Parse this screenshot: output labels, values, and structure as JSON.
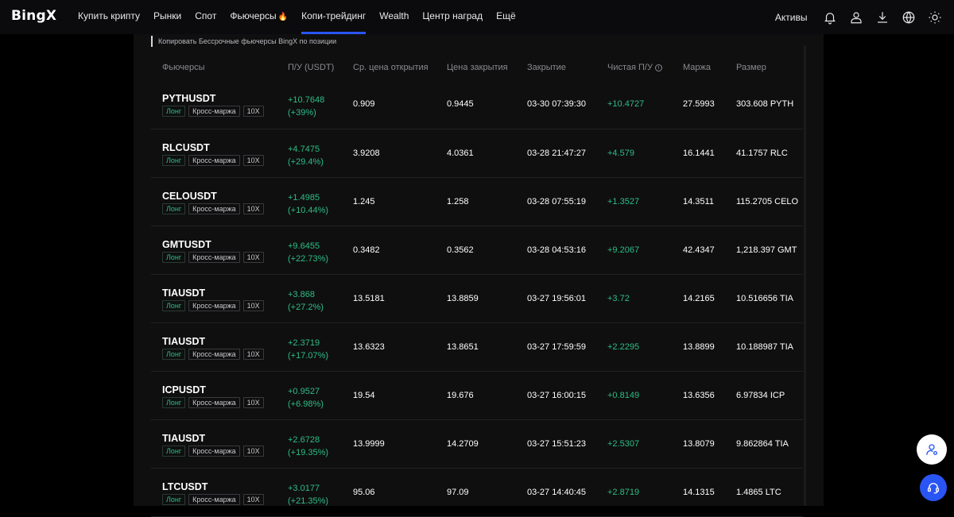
{
  "brand": {
    "logo": "BingX",
    "accent": "#2a55f5",
    "positive": "#2ebd85"
  },
  "nav": {
    "links": [
      {
        "label": "Купить крипту"
      },
      {
        "label": "Рынки"
      },
      {
        "label": "Спот"
      },
      {
        "label": "Фьючерсы"
      },
      {
        "label": "Копи-трейдинг",
        "active": true
      },
      {
        "label": "Wealth"
      },
      {
        "label": "Центр наград"
      },
      {
        "label": "Ещё"
      }
    ],
    "assets_label": "Активы",
    "icons": [
      "bell-icon",
      "user-icon",
      "download-icon",
      "globe-icon",
      "sun-icon"
    ]
  },
  "section_title": "Копировать Бессрочные фьючерсы BingX по позиции",
  "table": {
    "headers": {
      "futures": "Фьючерсы",
      "pnl": "П/У (USDT)",
      "open_price": "Ср. цена открытия",
      "close_price": "Цена закрытия",
      "close_time": "Закрытие",
      "net_pnl": "Чистая П/У",
      "margin": "Маржа",
      "size": "Размер"
    },
    "tags": {
      "side": "Лонг",
      "mode": "Кросс-маржа",
      "leverage": "10X"
    },
    "rows": [
      {
        "pair": "PYTHUSDT",
        "pnl": "+10.7648",
        "pnl_pct": "(+39%)",
        "open": "0.909",
        "close": "0.9445",
        "time": "03-30 07:39:30",
        "net": "+10.4727",
        "margin": "27.5993",
        "size": "303.608 PYTH"
      },
      {
        "pair": "RLCUSDT",
        "pnl": "+4.7475",
        "pnl_pct": "(+29.4%)",
        "open": "3.9208",
        "close": "4.0361",
        "time": "03-28 21:47:27",
        "net": "+4.579",
        "margin": "16.1441",
        "size": "41.1757 RLC"
      },
      {
        "pair": "CELOUSDT",
        "pnl": "+1.4985",
        "pnl_pct": "(+10.44%)",
        "open": "1.245",
        "close": "1.258",
        "time": "03-28 07:55:19",
        "net": "+1.3527",
        "margin": "14.3511",
        "size": "115.2705 CELO"
      },
      {
        "pair": "GMTUSDT",
        "pnl": "+9.6455",
        "pnl_pct": "(+22.73%)",
        "open": "0.3482",
        "close": "0.3562",
        "time": "03-28 04:53:16",
        "net": "+9.2067",
        "margin": "42.4347",
        "size": "1,218.397 GMT"
      },
      {
        "pair": "TIAUSDT",
        "pnl": "+3.868",
        "pnl_pct": "(+27.2%)",
        "open": "13.5181",
        "close": "13.8859",
        "time": "03-27 19:56:01",
        "net": "+3.72",
        "margin": "14.2165",
        "size": "10.516656 TIA"
      },
      {
        "pair": "TIAUSDT",
        "pnl": "+2.3719",
        "pnl_pct": "(+17.07%)",
        "open": "13.6323",
        "close": "13.8651",
        "time": "03-27 17:59:59",
        "net": "+2.2295",
        "margin": "13.8899",
        "size": "10.188987 TIA"
      },
      {
        "pair": "ICPUSDT",
        "pnl": "+0.9527",
        "pnl_pct": "(+6.98%)",
        "open": "19.54",
        "close": "19.676",
        "time": "03-27 16:00:15",
        "net": "+0.8149",
        "margin": "13.6356",
        "size": "6.97834 ICP"
      },
      {
        "pair": "TIAUSDT",
        "pnl": "+2.6728",
        "pnl_pct": "(+19.35%)",
        "open": "13.9999",
        "close": "14.2709",
        "time": "03-27 15:51:23",
        "net": "+2.5307",
        "margin": "13.8079",
        "size": "9.862864 TIA"
      },
      {
        "pair": "LTCUSDT",
        "pnl": "+3.0177",
        "pnl_pct": "(+21.35%)",
        "open": "95.06",
        "close": "97.09",
        "time": "03-27 14:40:45",
        "net": "+2.8719",
        "margin": "14.1315",
        "size": "1.4865 LTC"
      }
    ]
  }
}
